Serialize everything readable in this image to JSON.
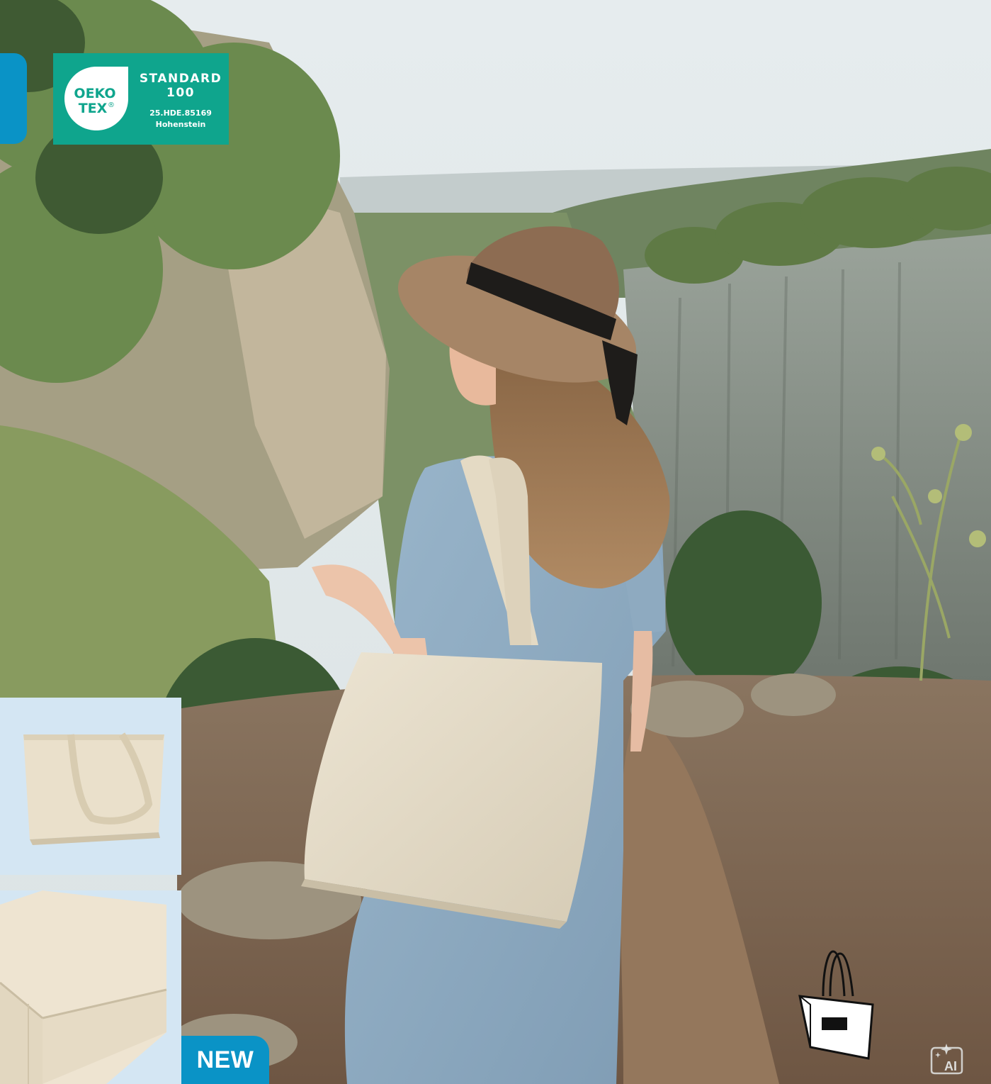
{
  "certificate": {
    "logo_line1": "OEKO",
    "logo_line2": "TEX",
    "registered_mark": "®",
    "standard_label": "STANDARD",
    "standard_number": "100",
    "cert_number": "25.HDE.85169",
    "institute": "Hohenstein",
    "brand_color": "#0fa58d"
  },
  "badge": {
    "label": "NEW",
    "color": "#0a93c6"
  },
  "icons": [
    "tote-bag-icon",
    "ai-sparkle-icon"
  ],
  "ai_icon_text": "AI"
}
